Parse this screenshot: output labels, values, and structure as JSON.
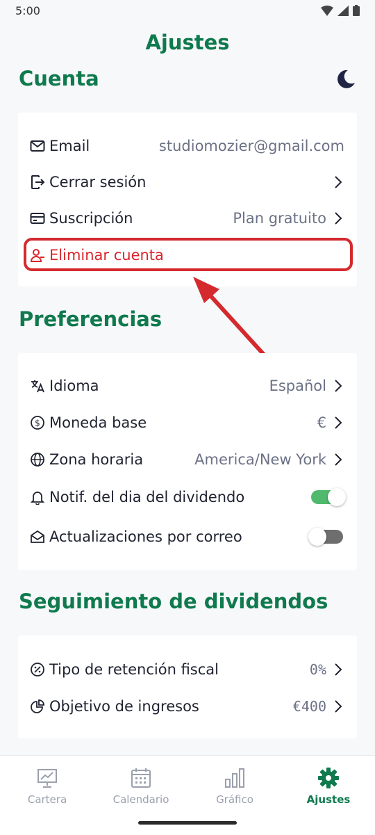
{
  "status_bar": {
    "time": "5:00"
  },
  "page_title": "Ajustes",
  "cuenta": {
    "title": "Cuenta",
    "rows": [
      {
        "label": "Email",
        "value": "studiomozier@gmail.com",
        "icon": "mail-icon"
      },
      {
        "label": "Cerrar sesión",
        "value": "",
        "icon": "logout-icon"
      },
      {
        "label": "Suscripción",
        "value": "Plan gratuito",
        "icon": "credit-card-icon"
      },
      {
        "label": "Eliminar cuenta",
        "value": "",
        "icon": "user-remove-icon"
      }
    ]
  },
  "preferencias": {
    "title": "Preferencias",
    "rows": [
      {
        "label": "Idioma",
        "value": "Español",
        "icon": "translate-icon"
      },
      {
        "label": "Moneda base",
        "value": "€",
        "icon": "dollar-circle-icon"
      },
      {
        "label": "Zona horaria",
        "value": "America/New York",
        "icon": "globe-icon"
      },
      {
        "label": "Notif. del dia del dividendo",
        "toggle": true,
        "icon": "bell-icon"
      },
      {
        "label": "Actualizaciones por correo",
        "toggle": false,
        "icon": "mail-open-icon"
      }
    ]
  },
  "seguimiento": {
    "title": "Seguimiento de dividendos",
    "rows": [
      {
        "label": "Tipo de retención fiscal",
        "value": "0%",
        "icon": "percent-icon"
      },
      {
        "label": "Objetivo de ingresos",
        "value": "€400",
        "icon": "pie-chart-icon"
      }
    ]
  },
  "bottom_nav": [
    {
      "label": "Cartera",
      "icon": "portfolio-chart-icon",
      "active": false
    },
    {
      "label": "Calendario",
      "icon": "calendar-icon",
      "active": false
    },
    {
      "label": "Gráfico",
      "icon": "bar-chart-icon",
      "active": false
    },
    {
      "label": "Ajustes",
      "icon": "gear-icon",
      "active": true
    }
  ],
  "colors": {
    "brand": "#0f7a4d",
    "danger": "#d8262c",
    "toggle_on": "#4fb96d",
    "muted": "#6b7286"
  }
}
